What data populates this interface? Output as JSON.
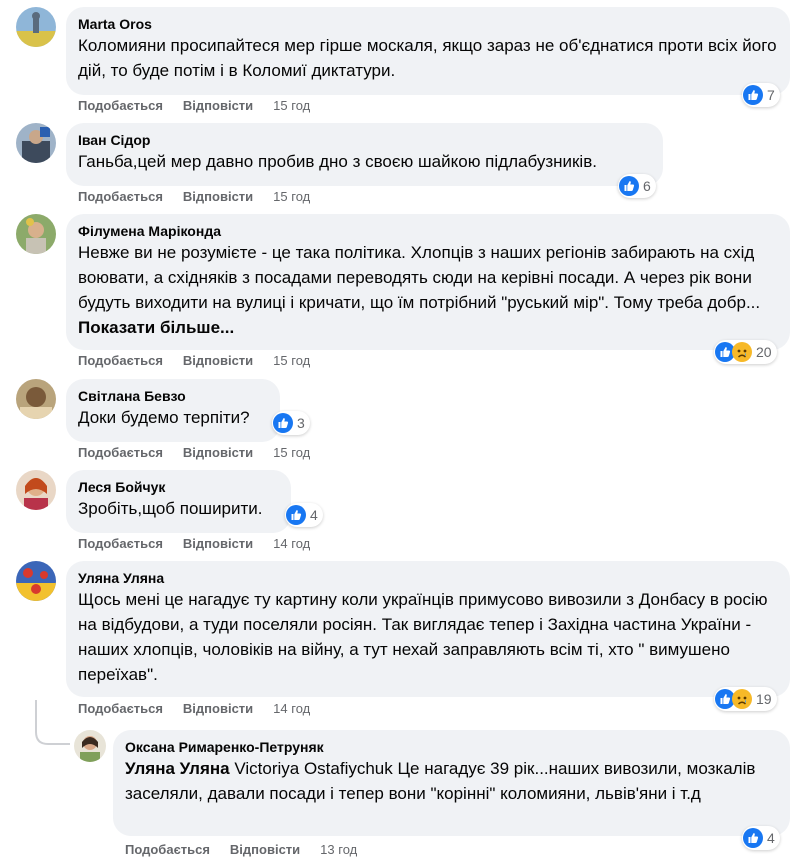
{
  "colors": {
    "bubble": "#f0f2f5",
    "action_text": "#65676b",
    "like_blue": "#1877f2",
    "sad_yellow": "#f7b928"
  },
  "comments": [
    {
      "author": "Marta Oros",
      "text": "Коломияни просипайтеся мер гірше москаля, якщо зараз не об'єднатися проти всіх його дій, то буде потім і в Коломиї диктатури.",
      "like_label": "Подобається",
      "reply_label": "Відповісти",
      "time": "15 год",
      "reactions": [
        "like-icon"
      ],
      "reaction_count": "7"
    },
    {
      "author": "Іван Сідор",
      "text": "Ганьба,цей мер давно пробив дно з своєю шайкою підлабузників.",
      "like_label": "Подобається",
      "reply_label": "Відповісти",
      "time": "15 год",
      "reactions": [
        "like-icon"
      ],
      "reaction_count": "6"
    },
    {
      "author": "Філумена Маріконда",
      "text": "Невже ви не розумієте - це така політика. Хлопців з наших регіонів забирають на схід воювати, а східняків з посадами переводять сюди на керівні посади. А через рік вони будуть виходити на вулиці і кричати, що їм потрібний \"руський мір\". Тому треба добр...",
      "see_more": "Показати більше...",
      "like_label": "Подобається",
      "reply_label": "Відповісти",
      "time": "15 год",
      "reactions": [
        "like-icon",
        "sad-icon"
      ],
      "reaction_count": "20"
    },
    {
      "author": "Світлана Бевзо",
      "text": "Доки будемо терпіти?",
      "like_label": "Подобається",
      "reply_label": "Відповісти",
      "time": "15 год",
      "reactions": [
        "like-icon"
      ],
      "reaction_count": "3"
    },
    {
      "author": "Леся Бойчук",
      "text": "Зробіть,щоб поширити.",
      "like_label": "Подобається",
      "reply_label": "Відповісти",
      "time": "14 год",
      "reactions": [
        "like-icon"
      ],
      "reaction_count": "4"
    },
    {
      "author": "Уляна Уляна",
      "text": "Щось мені це нагадує ту картину коли українців примусово вивозили з Донбасу в росію на відбудови, а туди поселяли росіян. Так виглядає тепер і Західна частина України - наших хлопців, чоловіків на війну, а тут нехай заправляють всім ті, хто \" вимушено переїхав\".",
      "like_label": "Подобається",
      "reply_label": "Відповісти",
      "time": "14 год",
      "reactions": [
        "like-icon",
        "sad-icon"
      ],
      "reaction_count": "19"
    },
    {
      "author": "Оксана Римаренко-Петруняк",
      "tagged": "Уляна Уляна",
      "text": " Victoriya Ostafiychuk Це нагадує 39 рік...наших вивозили, мозкалів заселяли, давали посади і тепер вони \"корінні\" коломияни, львів'яни і т.д",
      "like_label": "Подобається",
      "reply_label": "Відповісти",
      "time": "13 год",
      "reactions": [
        "like-icon"
      ],
      "reaction_count": "4"
    }
  ]
}
